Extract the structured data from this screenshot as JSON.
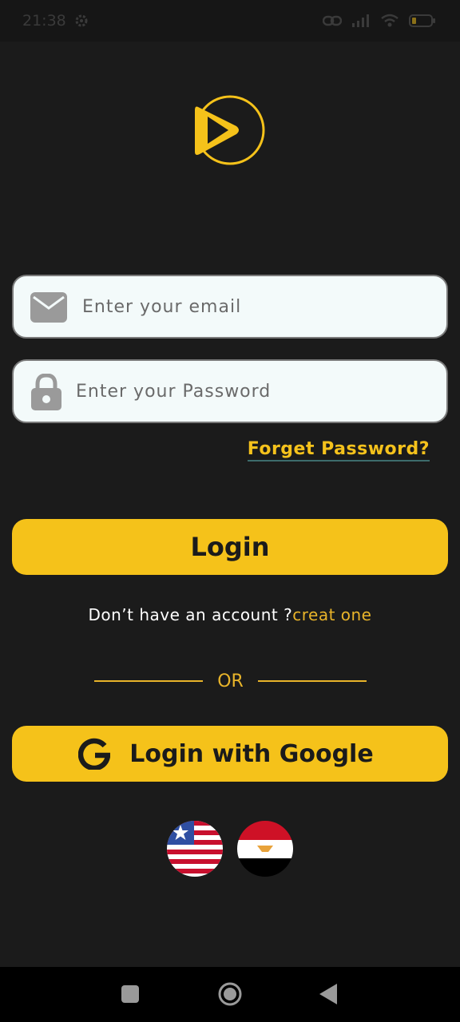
{
  "status_bar": {
    "time": "21:38",
    "icons": [
      "settings-gear-icon",
      "link-icon",
      "signal-icon",
      "wifi-icon",
      "battery-icon"
    ]
  },
  "logo": {
    "icon": "play-circle-logo",
    "accent_color": "#f5c21a"
  },
  "login_form": {
    "email": {
      "placeholder": "Enter your email",
      "value": "",
      "icon": "envelope-icon"
    },
    "password": {
      "placeholder": "Enter your Password",
      "value": "",
      "icon": "lock-icon"
    },
    "forget_password_label": "Forget Password?",
    "login_button_label": "Login"
  },
  "signup": {
    "prompt": "Don’t have an account ?",
    "link_label": "creat one"
  },
  "divider": {
    "label": "OR"
  },
  "google_login": {
    "label": "Login with Google",
    "icon": "google-g-icon"
  },
  "languages": [
    {
      "name": "english",
      "icon": "us-flag-icon"
    },
    {
      "name": "arabic",
      "icon": "egypt-flag-icon"
    }
  ],
  "nav_bar": {
    "icons": [
      "recents-square-icon",
      "home-circle-icon",
      "back-triangle-icon"
    ]
  },
  "colors": {
    "background": "#1b1b1b",
    "accent": "#f5c21a",
    "field_bg": "#f3fafa"
  }
}
